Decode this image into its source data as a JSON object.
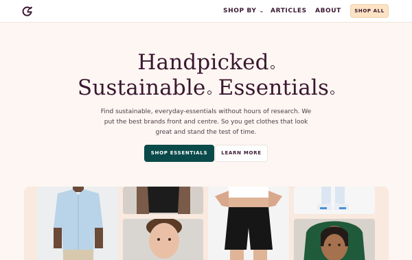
{
  "nav": {
    "logo_icon": "g-leaf-logo",
    "shop_by": "SHOP BY",
    "articles": "ARTICLES",
    "about": "ABOUT",
    "shop_all": "SHOP ALL"
  },
  "hero": {
    "title_line1": "Handpicked",
    "title_line2a": "Sustainable",
    "title_line2b": "Essentials",
    "subtitle": "Find sustainable, everyday-essentials without hours of research. We put the best brands front and centre. So you get clothes that look great and stand the test of time.",
    "primary_button": "SHOP ESSENTIALS",
    "secondary_button": "LEARN MORE"
  },
  "colors": {
    "background": "#fdf6f2",
    "text": "#3a1730",
    "primary": "#0b4a4a",
    "accent": "#fbe3c4"
  }
}
